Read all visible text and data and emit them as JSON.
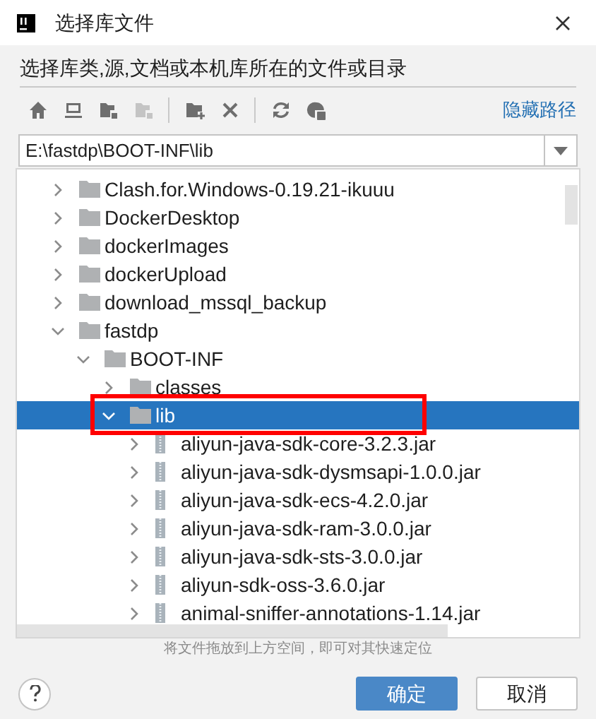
{
  "window": {
    "title": "选择库文件"
  },
  "description": "选择库类,源,文档或本机库所在的文件或目录",
  "toolbar": {
    "buttons": [
      {
        "kind": "home",
        "disabled": false
      },
      {
        "kind": "desktop",
        "disabled": false
      },
      {
        "kind": "folder-module",
        "disabled": false
      },
      {
        "kind": "folder-module",
        "disabled": true
      },
      {
        "kind": "new-folder",
        "disabled": false
      },
      {
        "kind": "delete",
        "disabled": false
      },
      {
        "kind": "refresh",
        "disabled": false
      },
      {
        "kind": "show-path",
        "disabled": false
      }
    ],
    "link": "隐藏路径"
  },
  "path_field": {
    "value": "E:\\fastdp\\BOOT-INF\\lib"
  },
  "tree": [
    {
      "label": "Clash.for.Windows-0.19.21-ikuuu",
      "kind": "folder",
      "expanded": false,
      "selected": false,
      "highlighted": false
    },
    {
      "label": "DockerDesktop",
      "kind": "folder",
      "expanded": false,
      "selected": false,
      "highlighted": false
    },
    {
      "label": "dockerImages",
      "kind": "folder",
      "expanded": false,
      "selected": false,
      "highlighted": false
    },
    {
      "label": "dockerUpload",
      "kind": "folder",
      "expanded": false,
      "selected": false,
      "highlighted": false
    },
    {
      "label": "download_mssql_backup",
      "kind": "folder",
      "expanded": false,
      "selected": false,
      "highlighted": false
    },
    {
      "label": "fastdp",
      "kind": "folder",
      "expanded": true,
      "selected": false,
      "highlighted": false,
      "children": [
        {
          "label": "BOOT-INF",
          "kind": "folder",
          "expanded": true,
          "selected": false,
          "highlighted": false,
          "children": [
            {
              "label": "classes",
              "kind": "folder",
              "expanded": false,
              "selected": false,
              "highlighted": false
            },
            {
              "label": "lib",
              "kind": "folder",
              "expanded": true,
              "selected": true,
              "highlighted": true,
              "children": [
                {
                  "label": "aliyun-java-sdk-core-3.2.3.jar",
                  "kind": "jar",
                  "expanded": false,
                  "selected": false,
                  "highlighted": false
                },
                {
                  "label": "aliyun-java-sdk-dysmsapi-1.0.0.jar",
                  "kind": "jar",
                  "expanded": false,
                  "selected": false,
                  "highlighted": false
                },
                {
                  "label": "aliyun-java-sdk-ecs-4.2.0.jar",
                  "kind": "jar",
                  "expanded": false,
                  "selected": false,
                  "highlighted": false
                },
                {
                  "label": "aliyun-java-sdk-ram-3.0.0.jar",
                  "kind": "jar",
                  "expanded": false,
                  "selected": false,
                  "highlighted": false
                },
                {
                  "label": "aliyun-java-sdk-sts-3.0.0.jar",
                  "kind": "jar",
                  "expanded": false,
                  "selected": false,
                  "highlighted": false
                },
                {
                  "label": "aliyun-sdk-oss-3.6.0.jar",
                  "kind": "jar",
                  "expanded": false,
                  "selected": false,
                  "highlighted": false
                },
                {
                  "label": "animal-sniffer-annotations-1.14.jar",
                  "kind": "jar",
                  "expanded": false,
                  "selected": false,
                  "highlighted": false
                }
              ]
            }
          ]
        }
      ]
    }
  ],
  "hint": "将文件拖放到上方空间，即可对其快速定位",
  "buttons": [
    {
      "label": "确定",
      "kind": "primary"
    },
    {
      "label": "取消",
      "kind": "secondary"
    }
  ]
}
